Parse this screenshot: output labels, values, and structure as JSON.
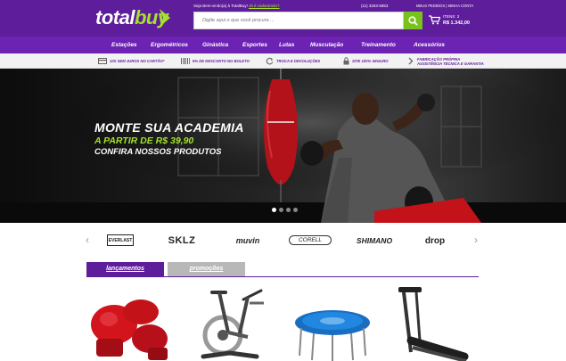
{
  "header": {
    "logo_total": "total",
    "logo_buy": "buy",
    "welcome": "Seja Bem-vindo(a) à TotalBuy!",
    "welcome_link": "Já é cadastrado?",
    "search_placeholder": "Digite aqui o que você procura ...",
    "phone": "(11) 3263-5853",
    "account_links": "MEUS PEDIDOS | MINHA CONTA",
    "cart_items": "ITENS: 3",
    "cart_total": "R$ 1.342,00",
    "brand_color": "#5e1d9a",
    "accent_color": "#a4e22c"
  },
  "nav": {
    "items": [
      "Estações",
      "Ergométricos",
      "Ginástica",
      "Esportes",
      "Lutas",
      "Musculação",
      "Treinamento",
      "Acessórios"
    ]
  },
  "benefits": [
    {
      "icon": "card-icon",
      "text": "10X SEM JUROS NO CARTÃO*"
    },
    {
      "icon": "barcode-icon",
      "text": "5% DE DESCONTO NO BOLETO"
    },
    {
      "icon": "refresh-icon",
      "text": "TROCA E DEVOLUÇÕES"
    },
    {
      "icon": "lock-icon",
      "text": "SITE 100% SEGURO"
    },
    {
      "icon": "chevron-icon",
      "text_line1": "FABRICAÇÃO PRÓPRIA",
      "text_line2": "ASSISTÊNCIA TÉCNICA E GARANTIA"
    }
  ],
  "banner": {
    "title": "MONTE SUA ACADEMIA",
    "price": "A PARTIR DE R$ 39,90",
    "cta": "CONFIRA NOSSOS PRODUTOS"
  },
  "brands": [
    "EVERLAST",
    "SKLZ",
    "muvin",
    "CORELL",
    "SHIMANO",
    "drop"
  ],
  "tabs": {
    "launch": "lançamentos",
    "promo": "promoções"
  },
  "products": [
    {
      "name": "boxing-gloves"
    },
    {
      "name": "spinning-bike"
    },
    {
      "name": "mini-trampoline"
    },
    {
      "name": "treadmill"
    }
  ]
}
